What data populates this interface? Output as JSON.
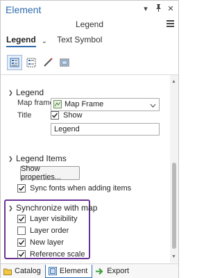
{
  "window": {
    "title": "Element",
    "controls": [
      "chevron-down-icon",
      "pin-icon",
      "close-icon"
    ],
    "subtitle": "Legend",
    "menu_icon": "hamburger-menu-icon"
  },
  "tabs": {
    "active": "Legend",
    "other": "Text Symbol"
  },
  "toolbar_icons": [
    "legend-options-icon",
    "legend-arrangement-icon",
    "pen-icon",
    "display-icon"
  ],
  "sections": {
    "legend": {
      "header": "Legend",
      "map_frame_label": "Map frame",
      "map_frame_value": "Map Frame",
      "title_label": "Title",
      "show_label": "Show",
      "show_checked": true,
      "title_value": "Legend"
    },
    "legend_items": {
      "header": "Legend Items",
      "show_properties_button": "Show properties...",
      "sync_fonts_label": "Sync fonts when adding items",
      "sync_fonts_checked": true
    },
    "synchronize": {
      "header": "Synchronize with map",
      "options": [
        {
          "label": "Layer visibility",
          "checked": true
        },
        {
          "label": "Layer order",
          "checked": false
        },
        {
          "label": "New layer",
          "checked": true
        },
        {
          "label": "Reference scale",
          "checked": true
        }
      ]
    }
  },
  "bottom_tabs": [
    {
      "label": "Catalog",
      "icon": "catalog-icon",
      "active": false
    },
    {
      "label": "Element",
      "icon": "element-icon",
      "active": true
    },
    {
      "label": "Export",
      "icon": "export-arrow-icon",
      "active": false
    }
  ],
  "colors": {
    "accent": "#2e6cad",
    "highlight_border": "#6a3295"
  }
}
